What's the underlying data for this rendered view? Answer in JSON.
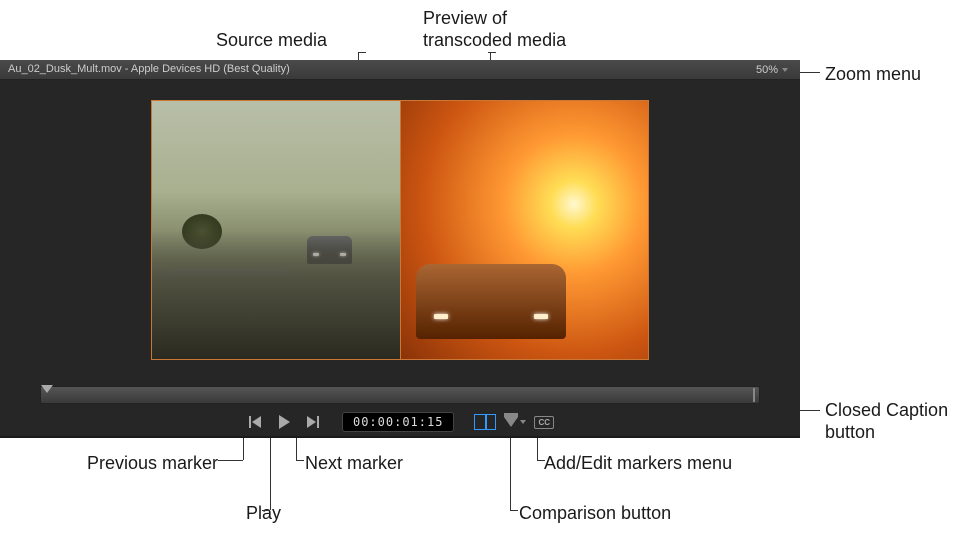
{
  "callouts": {
    "source_media": "Source media",
    "preview_transcoded": "Preview of\ntranscoded media",
    "zoom_menu": "Zoom menu",
    "closed_caption": "Closed Caption\nbutton",
    "previous_marker": "Previous marker",
    "play": "Play",
    "next_marker": "Next marker",
    "comparison_button": "Comparison button",
    "add_edit_markers": "Add/Edit markers menu"
  },
  "titlebar": {
    "title": "Au_02_Dusk_Mult.mov - Apple Devices HD (Best Quality)",
    "zoom": "50%"
  },
  "transport": {
    "timecode": "00:00:01:15",
    "cc_label": "CC"
  }
}
